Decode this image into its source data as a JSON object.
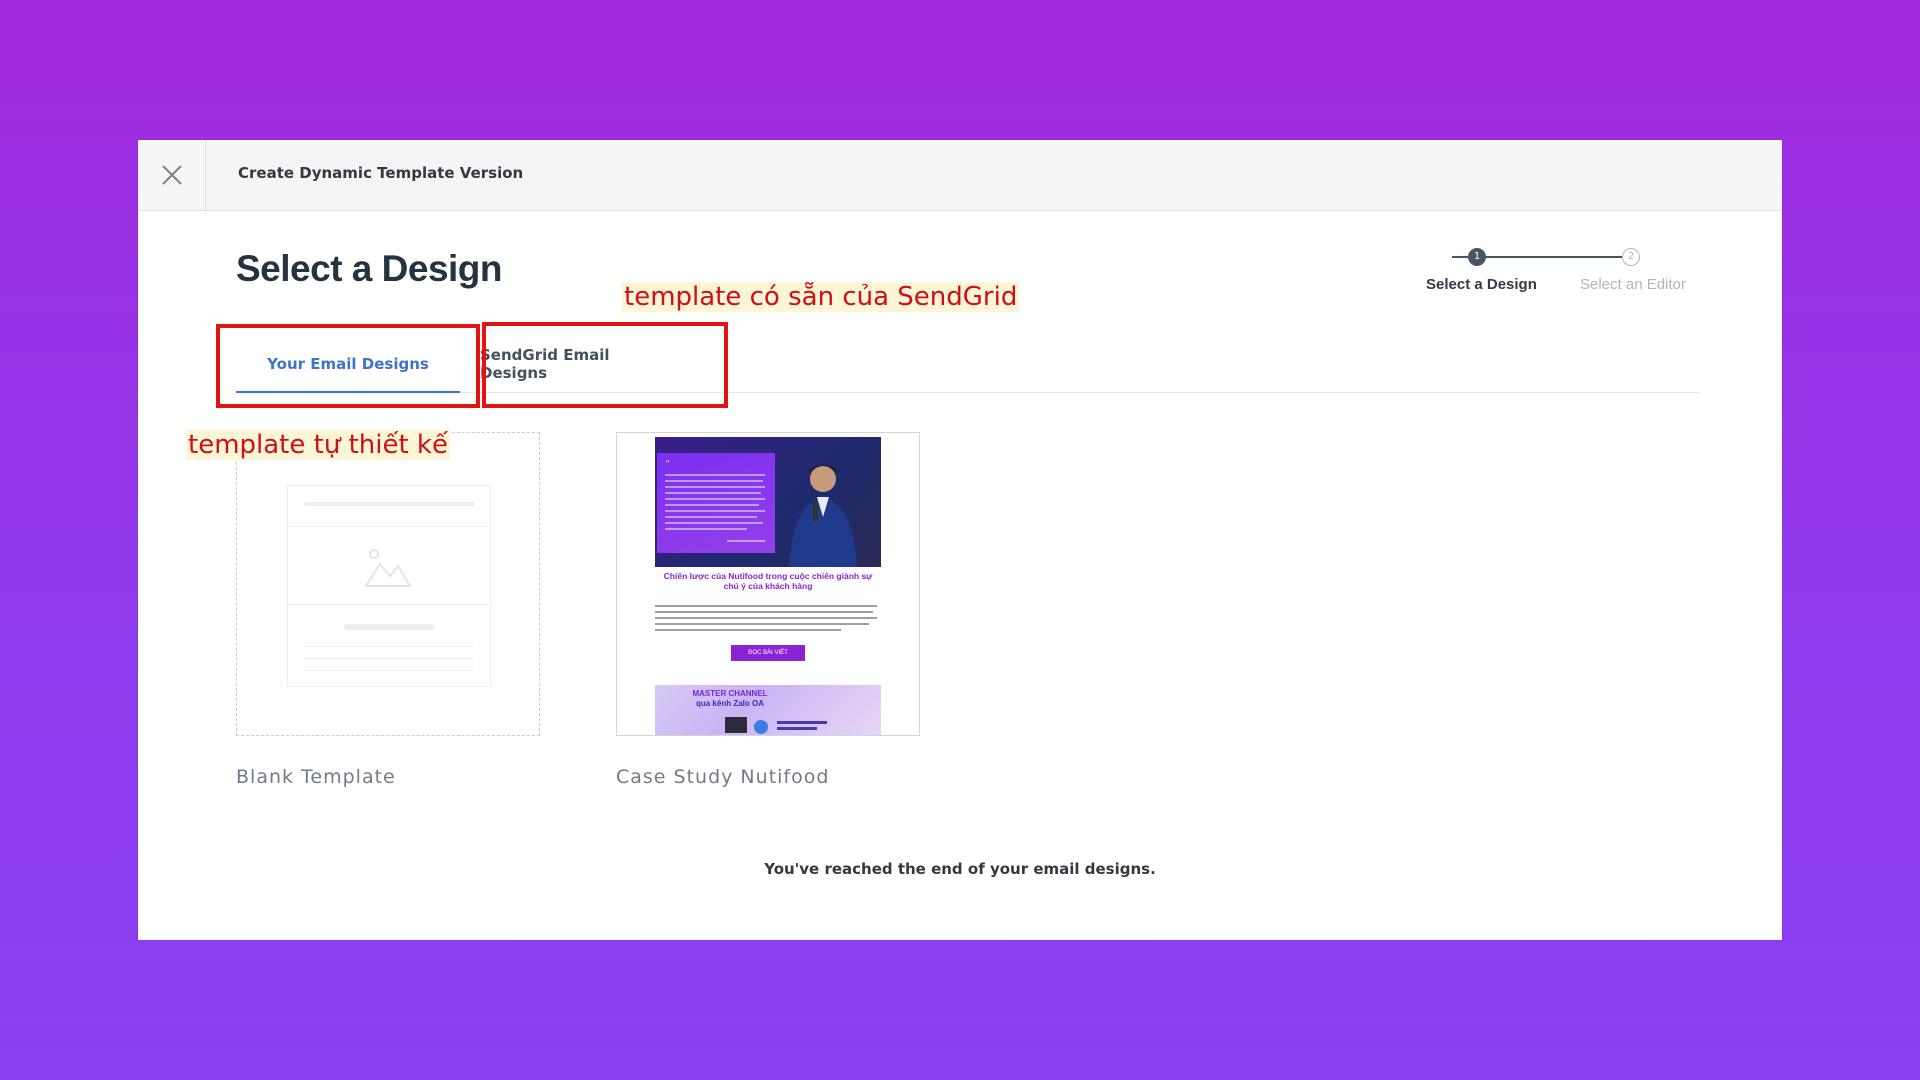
{
  "header": {
    "close_icon": "close-icon",
    "title": "Create Dynamic Template Version"
  },
  "page": {
    "title": "Select a Design"
  },
  "stepper": {
    "steps": [
      {
        "number": "1",
        "label": "Select a Design",
        "state": "active"
      },
      {
        "number": "2",
        "label": "Select an Editor",
        "state": "inactive"
      }
    ]
  },
  "tabs": [
    {
      "label": "Your Email Designs",
      "state": "active"
    },
    {
      "label": "SendGrid Email Designs",
      "state": "inactive"
    }
  ],
  "annotations": {
    "sendgrid_note": "template có sẵn của SendGrid",
    "own_note": "template tự thiết kế",
    "box_color": "#e41313"
  },
  "cards": [
    {
      "label": "Blank Template",
      "preview": "blank-template-illustration"
    },
    {
      "label": "Case Study Nutifood",
      "preview": {
        "heading": "Chiến lược của Nutifood trong cuộc chiến giành sự chú ý của khách hàng",
        "button": "ĐỌC BÀI VIẾT",
        "banner_line1": "MASTER CHANNEL",
        "banner_line2": "qua kênh Zalo OA"
      }
    }
  ],
  "footer": {
    "end_message": "You've reached the end of your email designs."
  },
  "colors": {
    "accent": "#3d74c9",
    "background_top": "#a32add",
    "background_bottom": "#8a3ff2"
  }
}
